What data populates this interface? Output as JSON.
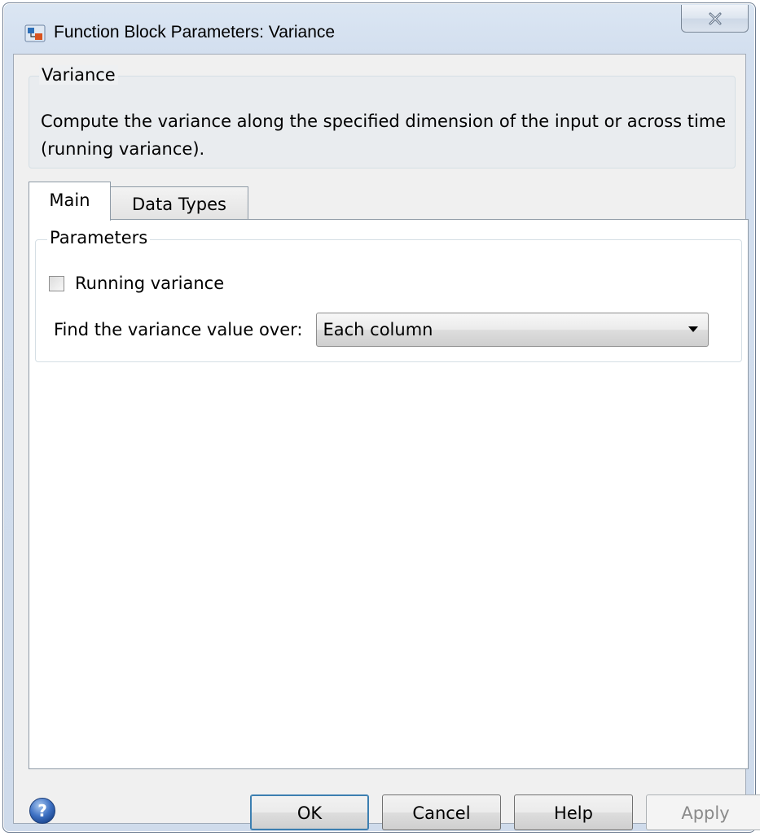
{
  "window": {
    "title": "Function Block Parameters: Variance"
  },
  "description": {
    "group_label": "Variance",
    "text": "Compute the variance along the specified dimension of the input or across time (running variance)."
  },
  "tabs": [
    {
      "label": "Main",
      "selected": true
    },
    {
      "label": "Data Types",
      "selected": false
    }
  ],
  "parameters": {
    "group_label": "Parameters",
    "running_variance_label": "Running variance",
    "running_variance_checked": false,
    "find_label": "Find the variance value over:",
    "find_value": "Each column"
  },
  "buttons": {
    "ok": "OK",
    "cancel": "Cancel",
    "help": "Help",
    "apply": "Apply"
  },
  "icons": {
    "app": "simulink-block-icon",
    "close": "close-icon",
    "help": "help-question-icon",
    "dropdown": "dropdown-arrow-icon"
  }
}
